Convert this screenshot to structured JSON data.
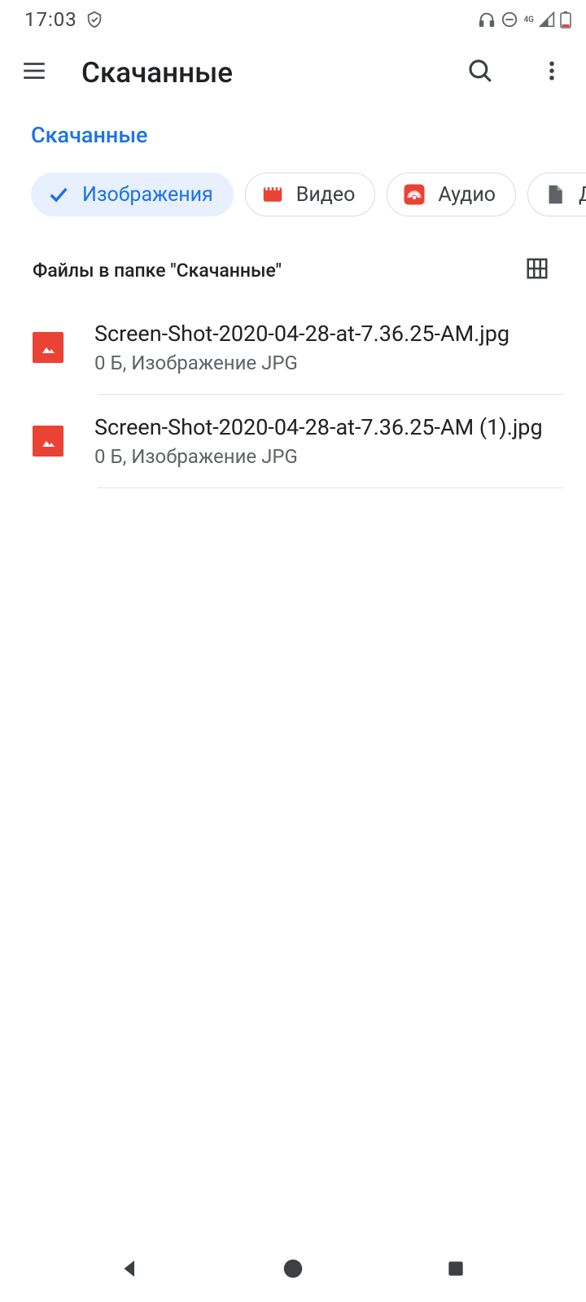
{
  "status": {
    "time": "17:03",
    "network_label": "4G"
  },
  "appbar": {
    "title": "Скачанные"
  },
  "breadcrumb": {
    "label": "Скачанные"
  },
  "chips": [
    {
      "label": "Изображения",
      "icon": "check-icon",
      "selected": true
    },
    {
      "label": "Видео",
      "icon": "video-icon",
      "selected": false
    },
    {
      "label": "Аудио",
      "icon": "audio-icon",
      "selected": false
    },
    {
      "label": "До",
      "icon": "document-icon",
      "selected": false
    }
  ],
  "section": {
    "title": "Файлы в папке \"Скачанные\""
  },
  "files": [
    {
      "name": "Screen-Shot-2020-04-28-at-7.36.25-AM.jpg",
      "meta": "0 Б, Изображение JPG"
    },
    {
      "name": "Screen-Shot-2020-04-28-at-7.36.25-AM (1).jpg",
      "meta": "0 Б, Изображение JPG"
    }
  ]
}
